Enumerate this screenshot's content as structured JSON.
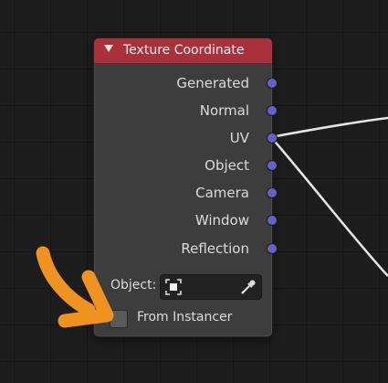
{
  "node": {
    "title": "Texture Coordinate",
    "outputs": [
      {
        "label": "Generated"
      },
      {
        "label": "Normal"
      },
      {
        "label": "UV"
      },
      {
        "label": "Object"
      },
      {
        "label": "Camera"
      },
      {
        "label": "Window"
      },
      {
        "label": "Reflection"
      }
    ],
    "object_label": "Object:",
    "object_value": "",
    "from_instancer_label": "From Instancer",
    "from_instancer_checked": false
  },
  "colors": {
    "header": "#a8313c",
    "socket": "#6363c7",
    "node_body": "#3d3d3d",
    "background": "#1d1d1d",
    "annotation_arrow": "#f0921f"
  },
  "icons": {
    "collapse": "triangle-down-icon",
    "object": "object-icon",
    "eyedropper": "eyedropper-icon"
  }
}
